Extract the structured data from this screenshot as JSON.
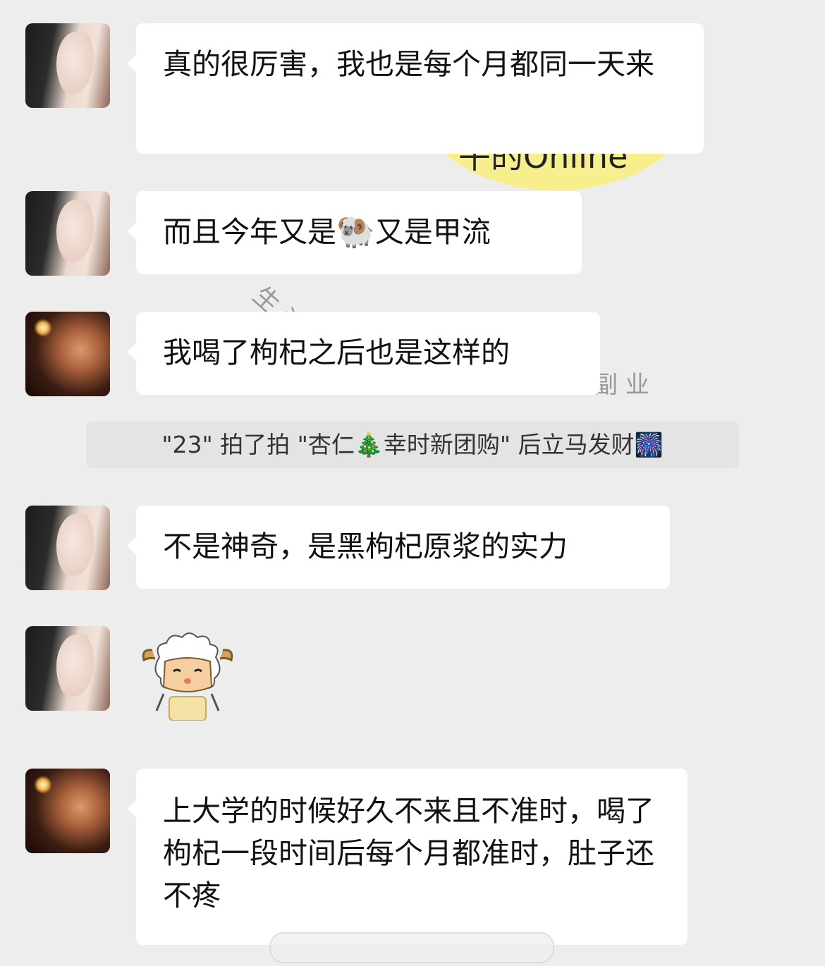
{
  "messages": [
    {
      "avatar": "avatar-woman-dark-hair",
      "text": "真的很厉害，我也是每个月都同一天来"
    },
    {
      "avatar": "avatar-woman-dark-hair",
      "text_before": "而且今年又是",
      "emoji": "🐏",
      "text_after": "又是甲流"
    },
    {
      "avatar": "avatar-woman-sparkler",
      "text": "我喝了枸杞之后也是这样的"
    },
    {
      "avatar": "avatar-woman-dark-hair",
      "text": "不是神奇，是黑枸杞原浆的实力"
    },
    {
      "avatar": "avatar-woman-dark-hair",
      "sticker": "pleasant-goat-sticker"
    },
    {
      "avatar": "avatar-woman-sparkler",
      "text": "上大学的时候好久不来且不准时，喝了枸杞一段时间后每个月都准时，肚子还不疼"
    }
  ],
  "system_notice": {
    "text_a": "\"23\" 拍了拍 \"杏仁",
    "icon_tree": "🎄",
    "text_b": "幸时新团购\" 后立马发财",
    "icon_firework": "🎆"
  },
  "watermark": {
    "bubble_text": "午的Online",
    "text_1": "生 活",
    "text_2": "副 业"
  }
}
